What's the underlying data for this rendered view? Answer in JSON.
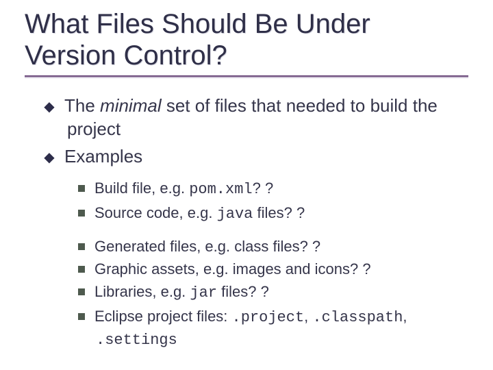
{
  "title": "What Files Should Be Under Version Control?",
  "bullets": {
    "b1": {
      "pre": "The ",
      "em": "minimal",
      "post": " set of files that needed to build the project"
    },
    "b2": "Examples"
  },
  "sub": {
    "s1": {
      "pre": "Build file, e.g. ",
      "code": "pom.xml",
      "post": "? ?"
    },
    "s2": {
      "pre": "Source code, e.g. ",
      "code": "java",
      "post": " files? ?"
    },
    "s3": {
      "text": "Generated files, e.g. class files? ?"
    },
    "s4": {
      "text": "Graphic assets, e.g. images and icons? ?"
    },
    "s5": {
      "pre": "Libraries, e.g. ",
      "code": "jar",
      "post": " files? ?"
    },
    "s6": {
      "pre": "Eclipse project files: ",
      "c1": ".project",
      "sep1": ", ",
      "c2": ".classpath",
      "sep2": ", ",
      "c3": ".settings"
    }
  }
}
